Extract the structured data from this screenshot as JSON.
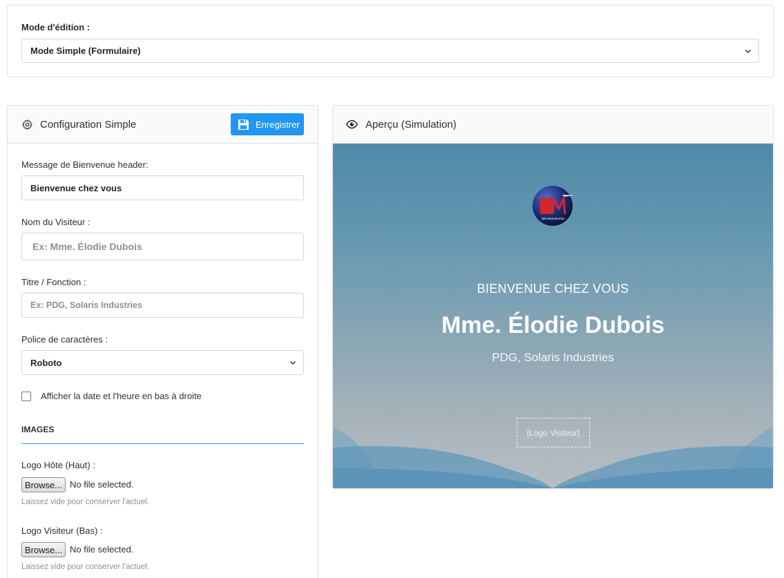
{
  "mode": {
    "label": "Mode d'édition :",
    "selected": "Mode Simple (Formulaire)"
  },
  "config": {
    "icon": "gear-icon",
    "title": "Configuration Simple",
    "save_label": "Enregistrer",
    "save_icon": "floppy-disk-icon",
    "welcome_label": "Message de Bienvenue header:",
    "welcome_value": "Bienvenue chez vous",
    "visitor_label": "Nom du Visiteur :",
    "visitor_placeholder": "Ex: Mme. Élodie Dubois",
    "title_label": "Titre / Fonction :",
    "title_placeholder": "Ex: PDG, Solaris Industries",
    "font_label": "Police de caractères :",
    "font_selected": "Roboto",
    "datetime_label": "Afficher la date et l'heure en bas à droite",
    "datetime_checked": false,
    "images_section": "IMAGES",
    "host_logo_label": "Logo Hôte (Haut) :",
    "visitor_logo_label": "Logo Visiteur (Bas) :",
    "browse_label": "Browse...",
    "no_file": "No file selected.",
    "help": "Laissez vide pour conserver l'actuel."
  },
  "preview": {
    "icon": "eye-icon",
    "title": "Aperçu (Simulation)",
    "logo_text": "BM Manutention",
    "welcome": "BIENVENUE CHEZ VOUS",
    "visitor_name": "Mme. Élodie Dubois",
    "visitor_title": "PDG, Solaris Industries",
    "visitor_logo_placeholder": "[Logo Visiteur]"
  },
  "colors": {
    "accent": "#2196f3",
    "border": "#dcdfe3",
    "preview_top": "#4f8aa8",
    "preview_bottom": "#b6bec4"
  }
}
